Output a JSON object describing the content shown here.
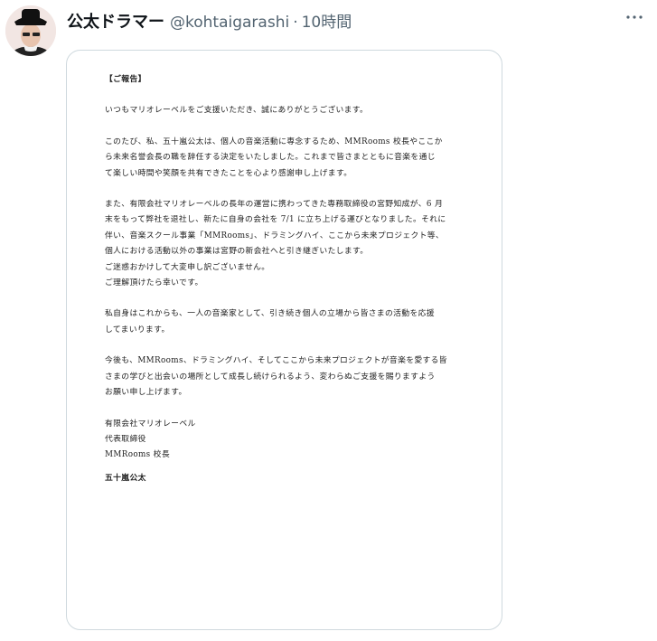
{
  "post": {
    "display_name": "公太ドラマー",
    "handle": "@kohtaigarashi",
    "separator": "·",
    "time": "10時間",
    "more_icon": "more-horizontal-icon"
  },
  "document": {
    "heading": "【ご報告】",
    "para1": [
      "いつもマリオレーベルをご支援いただき、誠にありがとうございます。"
    ],
    "para2": [
      "このたび、私、五十嵐公太は、個人の音楽活動に専念するため、MMRooms 校長やここか",
      "ら未来名誉会長の職を辞任する決定をいたしました。これまで皆さまとともに音楽を通じ",
      "て楽しい時間や笑顔を共有できたことを心より感謝申し上げます。"
    ],
    "para3": [
      "また、有限会社マリオレーベルの長年の運営に携わってきた専務取締役の宮野知成が、6 月",
      "末をもって弊社を退社し、新たに自身の会社を 7/1 に立ち上げる運びとなりました。それに",
      "伴い、音楽スクール事業「MMRooms」、ドラミングハイ、ここから未来プロジェクト等、",
      "個人における活動以外の事業は宮野の新会社へと引き継ぎいたします。",
      "ご迷惑おかけして大変申し訳ございません。",
      "ご理解頂けたら幸いです。"
    ],
    "para4": [
      "私自身はこれからも、一人の音楽家として、引き続き個人の立場から皆さまの活動を応援",
      "してまいります。"
    ],
    "para5": [
      "今後も、MMRooms、ドラミングハイ、そしてここから未来プロジェクトが音楽を愛する皆",
      "さまの学びと出会いの場所として成長し続けられるよう、変わらぬご支援を賜りますよう",
      "お願い申し上げます。"
    ],
    "signature": [
      "有限会社マリオレーベル",
      "代表取締役",
      "MMRooms 校長"
    ],
    "signer": "五十嵐公太"
  }
}
